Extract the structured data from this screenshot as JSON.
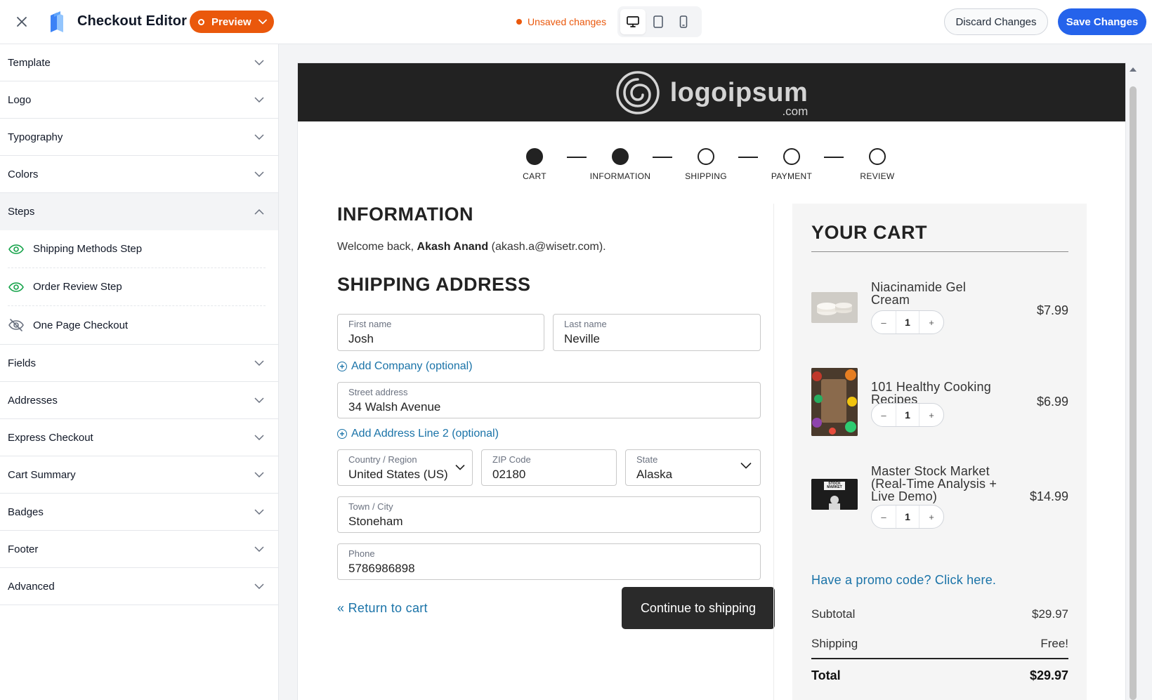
{
  "topbar": {
    "title": "Checkout Editor",
    "preview_label": "Preview",
    "unsaved_label": "Unsaved changes",
    "discard_label": "Discard Changes",
    "save_label": "Save Changes"
  },
  "sidebar": {
    "sections_top": [
      {
        "label": "Template"
      },
      {
        "label": "Logo"
      },
      {
        "label": "Typography"
      },
      {
        "label": "Colors"
      }
    ],
    "steps_section": {
      "label": "Steps",
      "items": [
        {
          "label": "Shipping Methods Step",
          "icon": "eye-icon"
        },
        {
          "label": "Order Review Step",
          "icon": "eye-icon"
        },
        {
          "label": "One Page Checkout",
          "icon": "eye-off-icon"
        }
      ]
    },
    "sections_bottom": [
      {
        "label": "Fields"
      },
      {
        "label": "Addresses"
      },
      {
        "label": "Express Checkout"
      },
      {
        "label": "Cart Summary"
      },
      {
        "label": "Badges"
      },
      {
        "label": "Footer"
      },
      {
        "label": "Advanced"
      }
    ]
  },
  "checkout": {
    "brand": {
      "name": "logoipsum",
      "suffix": ".com"
    },
    "steps": [
      {
        "label": "CART",
        "state": "done"
      },
      {
        "label": "INFORMATION",
        "state": "current"
      },
      {
        "label": "SHIPPING",
        "state": "todo"
      },
      {
        "label": "PAYMENT",
        "state": "todo"
      },
      {
        "label": "REVIEW",
        "state": "todo"
      }
    ],
    "info_heading": "INFORMATION",
    "welcome_prefix": "Welcome back,",
    "customer_name": "Akash Anand",
    "customer_email": "(akash.a@wisetr.com).",
    "shipping_heading": "SHIPPING ADDRESS",
    "fields": {
      "first_name": {
        "label": "First name",
        "value": "Josh"
      },
      "last_name": {
        "label": "Last name",
        "value": "Neville"
      },
      "street": {
        "label": "Street address",
        "value": "34 Walsh Avenue"
      },
      "country": {
        "label": "Country / Region",
        "value": "United States (US)"
      },
      "zip": {
        "label": "ZIP Code",
        "value": "02180"
      },
      "state": {
        "label": "State",
        "value": "Alaska"
      },
      "city": {
        "label": "Town / City",
        "value": "Stoneham"
      },
      "phone": {
        "label": "Phone",
        "value": "5786986898"
      }
    },
    "add_company": "Add Company (optional)",
    "add_address2": "Add Address Line 2 (optional)",
    "return_link": "« Return to cart",
    "continue_label": "Continue to shipping",
    "cart": {
      "title": "YOUR CART",
      "items": [
        {
          "name_l1": "Niacinamide Gel",
          "name_l2": "Cream",
          "name_l3": "",
          "qty": "1",
          "price": "$7.99"
        },
        {
          "name_l1": "101 Healthy Cooking",
          "name_l2": "Recipes",
          "name_l3": "",
          "qty": "1",
          "price": "$6.99"
        },
        {
          "name_l1": "Master Stock Market",
          "name_l2": "(Real-Time Analysis +",
          "name_l3": "Live Demo)",
          "qty": "1",
          "price": "$14.99",
          "thumb_text": "STOCK MARKET"
        }
      ],
      "promo": "Have a promo code? Click here.",
      "subtotal_label": "Subtotal",
      "subtotal_value": "$29.97",
      "shipping_label": "Shipping",
      "shipping_value": "Free!",
      "total_label": "Total",
      "total_value": "$29.97"
    }
  },
  "colors": {
    "accent_orange": "#ea580c",
    "primary_blue": "#2563eb",
    "link_blue": "#1a73a8",
    "eye_green": "#16a34a",
    "brand_bar": "#222222"
  }
}
